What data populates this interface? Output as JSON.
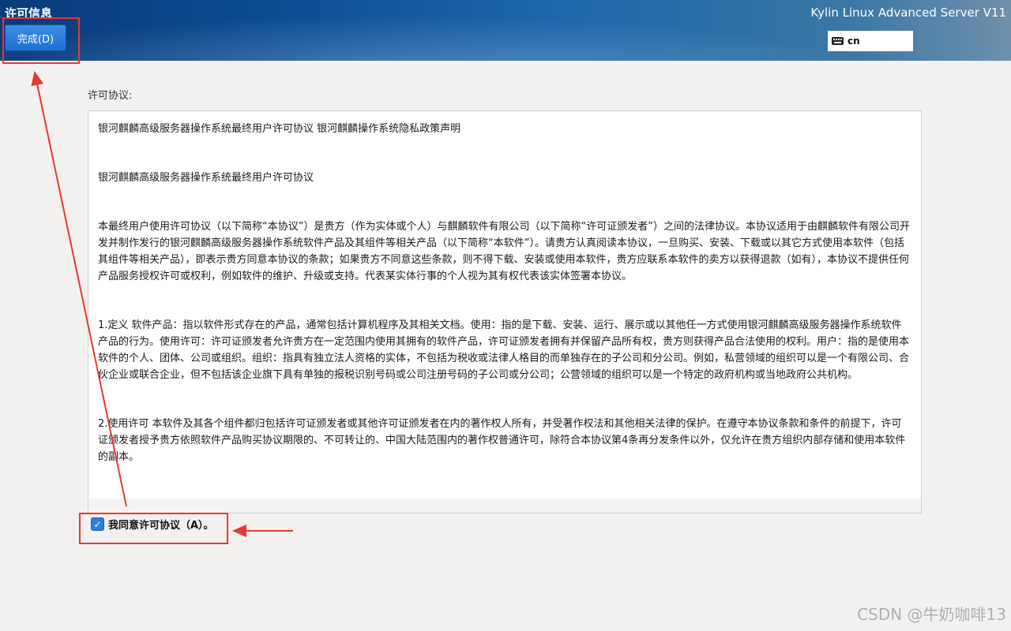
{
  "header": {
    "title": "许可信息",
    "done_label": "完成(D)",
    "product_name": "Kylin Linux Advanced Server V11",
    "keyboard_layout": "cn"
  },
  "license": {
    "label": "许可协议:",
    "paragraphs": [
      "银河麒麟高级服务器操作系统最终用户许可协议 银河麒麟操作系统隐私政策声明",
      " 银河麒麟高级服务器操作系统最终用户许可协议",
      " 本最终用户使用许可协议（以下简称“本协议”）是贵方（作为实体或个人）与麒麟软件有限公司（以下简称“许可证颁发者”）之间的法律协议。本协议适用于由麒麟软件有限公司开发并制作发行的银河麒麟高级服务器操作系统软件产品及其组件等相关产品（以下简称“本软件”）。请贵方认真阅读本协议，一旦购买、安装、下载或以其它方式使用本软件（包括其组件等相关产品），即表示贵方同意本协议的条款；如果贵方不同意这些条款，则不得下载、安装或使用本软件，贵方应联系本软件的卖方以获得退款（如有），本协议不提供任何产品服务授权许可或权利，例如软件的维护、升级或支持。代表某实体行事的个人视为其有权代表该实体签署本协议。",
      " 1.定义 软件产品：指以软件形式存在的产品，通常包括计算机程序及其相关文档。使用：指的是下载、安装、运行、展示或以其他任一方式使用银河麒麟高级服务器操作系统软件产品的行为。使用许可：许可证颁发者允许贵方在一定范围内使用其拥有的软件产品，许可证颁发者拥有并保留产品所有权，贵方则获得产品合法使用的权利。用户：指的是使用本软件的个人、团体、公司或组织。组织：指具有独立法人资格的实体，不包括为税收或法律人格目的而单独存在的子公司和分公司。例如，私营领域的组织可以是一个有限公司、合伙企业或联合企业，但不包括该企业旗下具有单独的报税识别号码或公司注册号码的子公司或分公司；公营领域的组织可以是一个特定的政府机构或当地政府公共机构。",
      " 2.使用许可 本软件及其各个组件都归包括许可证颁发者或其他许可证颁发者在内的著作权人所有，并受著作权法和其他相关法律的保护。在遵守本协议条款和条件的前提下，许可证颁发者授予贵方依照软件产品购买协议期限的、不可转让的、中国大陆范围内的著作权普通许可，除符合本协议第4条再分发条件以外，仅允许在贵方组织内部存储和使用本软件的副本。"
    ]
  },
  "agree": {
    "label": "我同意许可协议（A）。",
    "checked": true
  },
  "watermark": "CSDN @牛奶咖啡13",
  "colors": {
    "annotation_red": "#e53935",
    "accent_blue": "#2f7fd8"
  }
}
